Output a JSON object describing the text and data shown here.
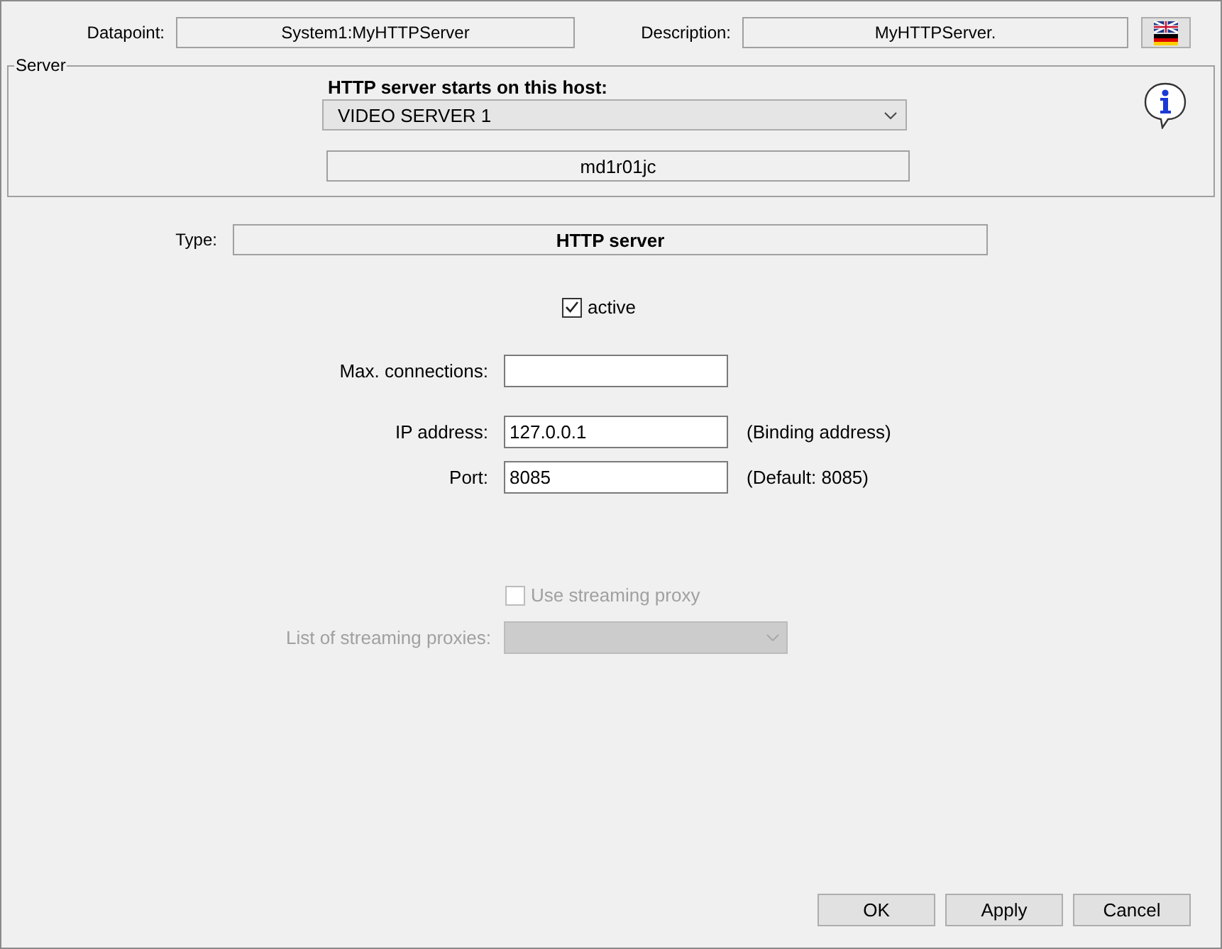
{
  "header": {
    "datapoint": {
      "label": "Datapoint:",
      "value": "System1:MyHTTPServer"
    },
    "description": {
      "label": "Description:",
      "value": "MyHTTPServer."
    }
  },
  "server": {
    "legend": "Server",
    "host_label": "HTTP server starts on this host:",
    "host": "VIDEO SERVER 1",
    "hostname": "md1r01jc"
  },
  "type": {
    "label": "Type:",
    "value": "HTTP server"
  },
  "active": {
    "label": "active",
    "checked": true
  },
  "fields": [
    {
      "label": "Max. connections:"
    },
    {
      "label": "IP address:",
      "value": "127.0.0.1",
      "note": "(Binding address)"
    },
    {
      "label": "Port:",
      "value": "8085",
      "note": "(Default: 8085)"
    }
  ],
  "streaming_proxy": {
    "label": "Use streaming proxy",
    "checked": false,
    "disabled": true
  },
  "proxy_list": {
    "label": "List of streaming proxies:",
    "disabled": true
  },
  "buttons": [
    "OK",
    "Apply",
    "Cancel"
  ]
}
